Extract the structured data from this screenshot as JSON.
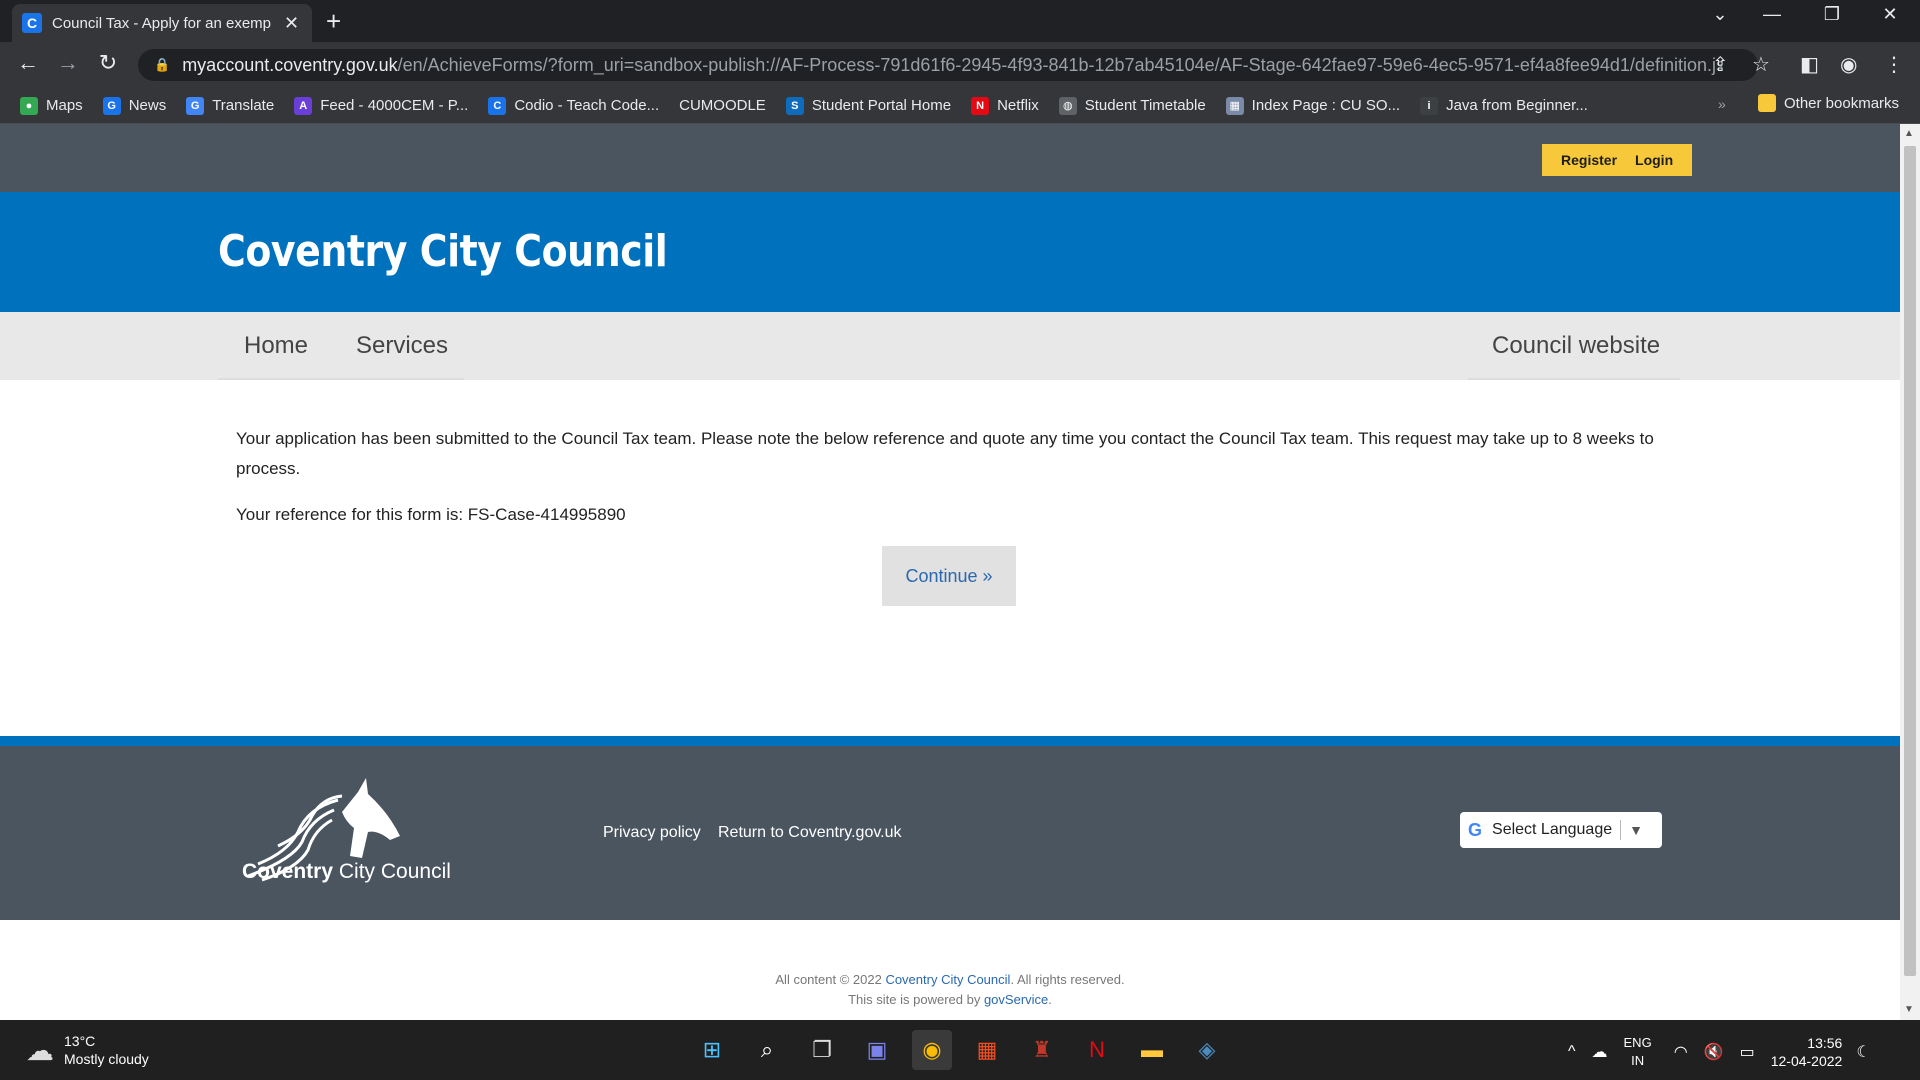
{
  "browser": {
    "tab_title": "Council Tax - Apply for an exemp",
    "tab_favicon": "C",
    "url_host": "myaccount.coventry.gov.uk",
    "url_path": "/en/AchieveForms/?form_uri=sandbox-publish://AF-Process-791d61f6-2945-4f93-841b-12b7ab45104e/AF-Stage-642fae97-59e6-4ec5-9571-ef4a8fee94d1/definition.jso...",
    "bookmarks": [
      {
        "label": "Maps",
        "icon": "maps-icon",
        "color": "#34a853",
        "glyph": "●"
      },
      {
        "label": "News",
        "icon": "news-icon",
        "color": "#1a73e8",
        "glyph": "G"
      },
      {
        "label": "Translate",
        "icon": "translate-icon",
        "color": "#4285f4",
        "glyph": "G"
      },
      {
        "label": "Feed - 4000CEM - P...",
        "icon": "feed-icon",
        "color": "#6a3fd8",
        "glyph": "A"
      },
      {
        "label": "Codio - Teach Code...",
        "icon": "codio-icon",
        "color": "#1a73e8",
        "glyph": "C"
      },
      {
        "label": "CUMOODLE",
        "icon": "",
        "color": "",
        "glyph": ""
      },
      {
        "label": "Student Portal Home",
        "icon": "sharepoint-icon",
        "color": "#0f6cbd",
        "glyph": "S"
      },
      {
        "label": "Netflix",
        "icon": "netflix-icon",
        "color": "#e50914",
        "glyph": "N"
      },
      {
        "label": "Student Timetable",
        "icon": "globe-icon",
        "color": "#5f6368",
        "glyph": "◍"
      },
      {
        "label": "Index Page : CU SO...",
        "icon": "page-icon",
        "color": "#7b8aa8",
        "glyph": "▦"
      },
      {
        "label": "Java from Beginner...",
        "icon": "java-icon",
        "color": "#3c4043",
        "glyph": "i"
      }
    ],
    "bookmarks_more": "»",
    "other_bookmarks": "Other bookmarks"
  },
  "site": {
    "register_label": "Register",
    "login_label": "Login",
    "title": "Coventry City Council",
    "nav": {
      "home": "Home",
      "services": "Services",
      "council_website": "Council website"
    },
    "message": "Your application has been submitted to the Council Tax team. Please note the below reference and quote any time you contact the Council Tax team. This request may take up to 8 weeks to process.",
    "reference": "Your reference for this form is: FS-Case-414995890",
    "continue_label": "Continue »",
    "footer": {
      "logo_text_1": "Coventry",
      "logo_text_2": " City Council",
      "privacy": "Privacy policy",
      "return": "Return to Coventry.gov.uk",
      "select_language": "Select Language"
    },
    "copyright_prefix": "All content © 2022 ",
    "copyright_org": "Coventry City Council",
    "copyright_suffix": ". All rights reserved.",
    "powered_prefix": "This site is powered by ",
    "powered_link": "govService",
    "powered_suffix": "."
  },
  "taskbar": {
    "temperature": "13°C",
    "weather": "Mostly cloudy",
    "lang_1": "ENG",
    "lang_2": "IN",
    "time": "13:56",
    "date": "12-04-2022"
  },
  "colors": {
    "brand_blue": "#0071bc",
    "header_grey": "#4a5560",
    "auth_yellow": "#f6c83a"
  }
}
